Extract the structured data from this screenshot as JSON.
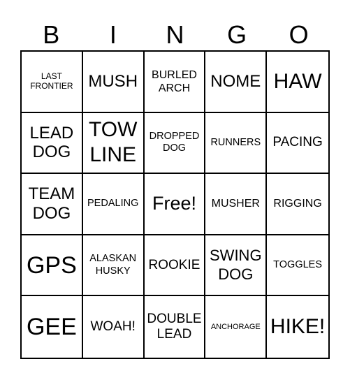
{
  "header": [
    "B",
    "I",
    "N",
    "G",
    "O"
  ],
  "cells": [
    [
      {
        "text": "LAST FRONTIER",
        "size": "s12"
      },
      {
        "text": "MUSH",
        "size": "s24"
      },
      {
        "text": "BURLED ARCH",
        "size": "s16"
      },
      {
        "text": "NOME",
        "size": "s24"
      },
      {
        "text": "HAW",
        "size": "s30"
      }
    ],
    [
      {
        "text": "LEAD DOG",
        "size": "s24"
      },
      {
        "text": "TOW LINE",
        "size": "s30"
      },
      {
        "text": "DROPPED DOG",
        "size": "s14"
      },
      {
        "text": "RUNNERS",
        "size": "s14"
      },
      {
        "text": "PACING",
        "size": "s19"
      }
    ],
    [
      {
        "text": "TEAM DOG",
        "size": "s24"
      },
      {
        "text": "PEDALING",
        "size": "s14"
      },
      {
        "text": "Free!",
        "size": "s27"
      },
      {
        "text": "MUSHER",
        "size": "s16"
      },
      {
        "text": "RIGGING",
        "size": "s16"
      }
    ],
    [
      {
        "text": "GPS",
        "size": "s34"
      },
      {
        "text": "ALASKAN HUSKY",
        "size": "s14"
      },
      {
        "text": "ROOKIE",
        "size": "s19"
      },
      {
        "text": "SWING DOG",
        "size": "s22"
      },
      {
        "text": "TOGGLES",
        "size": "s14"
      }
    ],
    [
      {
        "text": "GEE",
        "size": "s34"
      },
      {
        "text": "WOAH!",
        "size": "s19"
      },
      {
        "text": "DOUBLE LEAD",
        "size": "s19"
      },
      {
        "text": "ANCHORAGE",
        "size": "s11"
      },
      {
        "text": "HIKE!",
        "size": "s30"
      }
    ]
  ]
}
